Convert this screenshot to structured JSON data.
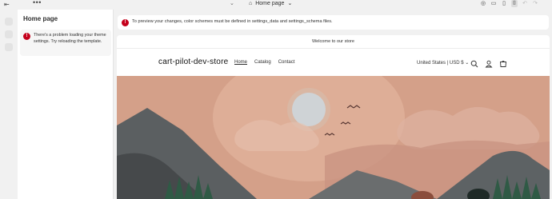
{
  "topbar": {
    "page_selector": "Home page",
    "page_chevron": "⌄"
  },
  "sidebar": {
    "title": "Home page",
    "alert": "There's a problem loading your theme settings. Try reloading the template."
  },
  "preview_notice": "To preview your changes, color schemes must be defined in settings_data and settings_schema files.",
  "store": {
    "announcement": "Welcome to our store",
    "name": "cart-pilot-dev-store",
    "nav": [
      "Home",
      "Catalog",
      "Contact"
    ],
    "locale": "United States | USD $"
  },
  "colors": {
    "error": "#c4001b",
    "sky": "#d4a089",
    "sun_halo": "#e2b39c",
    "sun": "#cfd3d6",
    "mountains": "#5b5f61",
    "trees": "#2f5a45"
  }
}
